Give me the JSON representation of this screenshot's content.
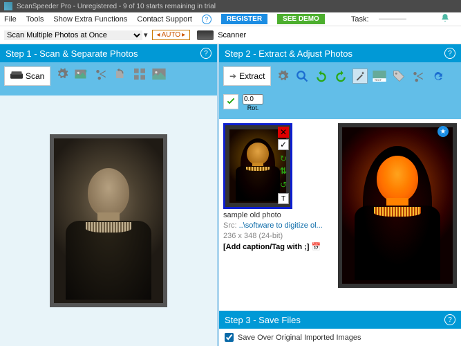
{
  "title": "ScanSpeeder Pro - Unregistered - 9 of 10 starts remaining in trial",
  "menu": {
    "file": "File",
    "tools": "Tools",
    "extra": "Show Extra Functions",
    "support": "Contact Support",
    "register": "REGISTER",
    "demo": "SEE DEMO",
    "task": "Task:"
  },
  "toolbar": {
    "scan_mode": "Scan Multiple Photos at Once",
    "auto": "AUTO",
    "scanner": "Scanner"
  },
  "step1": {
    "title": "Step 1 - Scan & Separate Photos",
    "scan": "Scan"
  },
  "step2": {
    "title": "Step 2 - Extract & Adjust Photos",
    "extract": "Extract",
    "rot_value": "0.0",
    "rot_label": "Rot.",
    "thumb_name": "sample old photo",
    "src_label": "Src:",
    "src_path": "..\\software to digitize ol...",
    "dimensions": "236 x 348 (24-bit)",
    "caption": "[Add caption/Tag with ;]"
  },
  "step3": {
    "title": "Step 3 - Save Files",
    "save_over": "Save Over Original Imported Images"
  }
}
